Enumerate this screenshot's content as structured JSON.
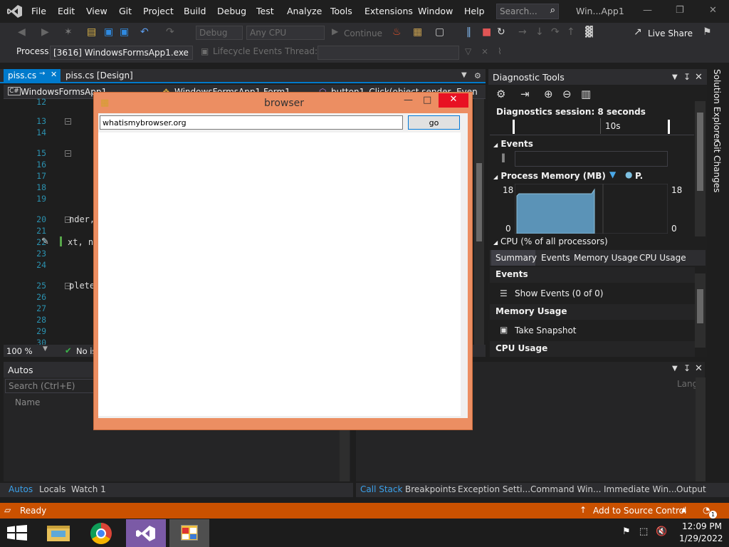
{
  "menu": [
    "File",
    "Edit",
    "View",
    "Git",
    "Project",
    "Build",
    "Debug",
    "Test",
    "Analyze",
    "Tools",
    "Extensions",
    "Window",
    "Help"
  ],
  "search_placeholder": "Search...",
  "window_title": "Win...App1",
  "toolbar": {
    "config": "Debug",
    "platform": "Any CPU",
    "continue": "Continue",
    "live_share": "Live Share"
  },
  "toolbar2": {
    "process_label": "Process:",
    "process_value": "[3616] WindowsFormsApp1.exe",
    "lifecycle": "Lifecycle Events",
    "thread": "Thread:"
  },
  "tabs": {
    "active": "piss.cs",
    "design": "piss.cs [Design]"
  },
  "navbar": {
    "project": "WindowsFormsApp1",
    "class": "WindowsFormsApp1.Form1",
    "member": "button1_Click(object sender, Even"
  },
  "editor": {
    "lines": [
      "12",
      "13",
      "14",
      "15",
      "16",
      "17",
      "18",
      "19",
      "20",
      "21",
      "22",
      "23",
      "24",
      "25",
      "26",
      "27",
      "28",
      "29",
      "30"
    ],
    "code_20": "nder,",
    "code_22": "xt, n",
    "code_25": "plete"
  },
  "editor_status": {
    "zoom": "100 %",
    "issues": "No is"
  },
  "autos": {
    "title": "Autos",
    "search": "Search (Ctrl+E)",
    "col_name": "Name",
    "lang_col": "Lang"
  },
  "bottom_tabs_left": [
    "Autos",
    "Locals",
    "Watch 1"
  ],
  "bottom_tabs_right": [
    "Call Stack",
    "Breakpoints",
    "Exception Setti...",
    "Command Win...",
    "Immediate Win...",
    "Output"
  ],
  "diag": {
    "title": "Diagnostic Tools",
    "session": "Diagnostics session: 8 seconds",
    "time_mark": "10s",
    "events": "Events",
    "process_memory": "Process Memory (MB)",
    "legend_p": "P.",
    "mem_max_left": "18",
    "mem_min_left": "0",
    "mem_max_right": "18",
    "mem_min_right": "0",
    "cpu": "CPU (% of all processors)",
    "summary_tabs": [
      "Summary",
      "Events",
      "Memory Usage",
      "CPU Usage"
    ],
    "sec_events": "Events",
    "show_events": "Show Events (0 of 0)",
    "sec_memory": "Memory Usage",
    "take_snapshot": "Take Snapshot",
    "sec_cpu": "CPU Usage"
  },
  "side_tabs": [
    "Solution Explorer",
    "Git Changes"
  ],
  "status": {
    "ready": "Ready",
    "source_control": "Add to Source Control",
    "notifications": "1"
  },
  "taskbar": {
    "time": "12:09 PM",
    "date": "1/29/2022"
  },
  "browser": {
    "title": "browser",
    "url": "whatismybrowser.org",
    "go": "go"
  },
  "colors": {
    "accent": "#007acc",
    "status": "#ca5100",
    "browser_border": "#ec8e62"
  }
}
